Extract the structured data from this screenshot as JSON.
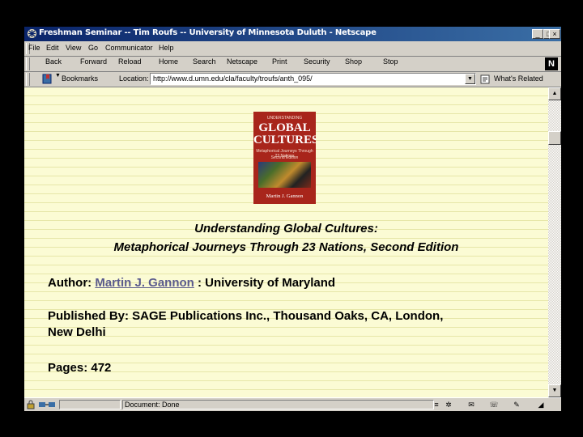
{
  "window": {
    "title": "Freshman Seminar -- Tim Roufs -- University of Minnesota Duluth - Netscape",
    "controls": [
      "_",
      "□",
      "×"
    ]
  },
  "menu": [
    "File",
    "Edit",
    "View",
    "Go",
    "Communicator",
    "Help"
  ],
  "nav_buttons": [
    "Back",
    "Forward",
    "Reload",
    "Home",
    "Search",
    "Netscape",
    "Print",
    "Security",
    "Shop",
    "Stop"
  ],
  "location": {
    "bookmarks_label": "Bookmarks",
    "location_label": "Location:",
    "url": "http://www.d.umn.edu/cla/faculty/troufs/anth_095/",
    "related_label": "What's Related"
  },
  "book_cover": {
    "top_text": "UNDERSTANDING",
    "title_line1": "GLOBAL",
    "title_line2": "CULTURES",
    "subtitle": "Metaphorical Journeys Through 23 Nations",
    "edition": "Second Edition",
    "author": "Martin J. Gannon"
  },
  "page": {
    "title_line1": "Understanding Global Cultures:",
    "title_line2": "Metaphorical Journeys Through 23 Nations, Second Edition",
    "author_label": "Author:",
    "author_name": "Martin J. Gannon",
    "author_affiliation": ": University of Maryland",
    "published_line1": "Published By: SAGE Publications Inc., Thousand Oaks, CA, London,",
    "published_line2": "New Delhi",
    "pages": "Pages: 472"
  },
  "status": {
    "text": "Document: Done"
  },
  "colors": {
    "titlebar": "#0a246a",
    "page_background": "#fbfbd4",
    "link": "#5a5a8c",
    "book_cover": "#a8251b"
  }
}
